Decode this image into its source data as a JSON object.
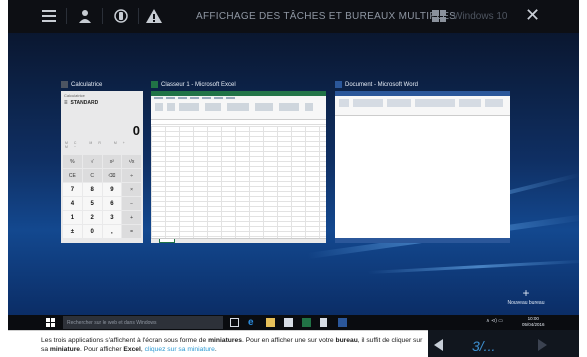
{
  "toolbar": {
    "title": "AFFICHAGE DES TÂCHES ET BUREAUX MULTIPLES",
    "windows_label": "Windows 10",
    "close_glyph": "✕",
    "icons": [
      "list-icon",
      "user-icon",
      "hand-icon",
      "warning-icon"
    ]
  },
  "windows": [
    {
      "title": "Calculatrice",
      "icon": "calculator-icon"
    },
    {
      "title": "Classeur 1 - Microsoft Excel",
      "icon": "excel-icon"
    },
    {
      "title": "Document - Microsoft Word",
      "icon": "word-icon"
    }
  ],
  "calculator": {
    "header": "Calculatrice",
    "mode": "STANDARD",
    "display": "0",
    "keys": [
      "%",
      "√",
      "x²",
      "¹/x",
      "CE",
      "C",
      "⌫",
      "÷",
      "7",
      "8",
      "9",
      "×",
      "4",
      "5",
      "6",
      "−",
      "1",
      "2",
      "3",
      "+",
      "±",
      "0",
      ",",
      "="
    ]
  },
  "new_desktop": {
    "plus": "+",
    "label": "Nouveau bureau"
  },
  "taskbar": {
    "search_placeholder": "Rechercher sur le web et dans Windows",
    "tray": "∧ ⊲) ▭",
    "time": "10:00",
    "date": "05/04/2016"
  },
  "caption": {
    "part1": "Les trois applications s'affichent à l'écran sous forme de ",
    "miniatures": "miniatures",
    "part2": ". Pour en afficher une sur votre ",
    "bureau": "bureau",
    "part3": ", il suffit de cliquer sur sa ",
    "miniature": "miniature",
    "part4": ". Pour afficher ",
    "excel": "Excel",
    "part5": ", ",
    "highlight": "cliquez sur sa miniature",
    "part6": "."
  },
  "nav": {
    "page": "3/..."
  },
  "colors": {
    "excel": "#217346",
    "word": "#2b579a",
    "accent": "#2e9bd3"
  }
}
